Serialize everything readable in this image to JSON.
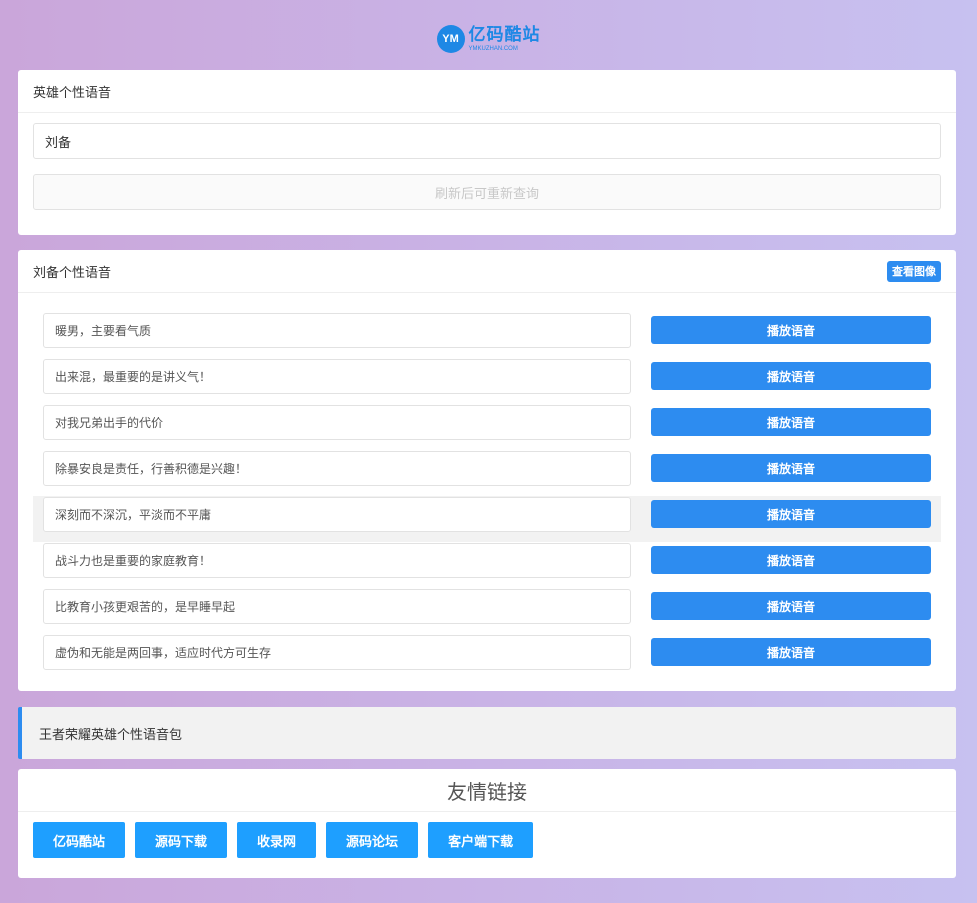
{
  "logo": {
    "mark": "YM",
    "title": "亿码酷站",
    "subtitle": "YMKUZHAN.COM"
  },
  "search_card": {
    "title": "英雄个性语音",
    "input_value": "刘备",
    "button_label": "刷新后可重新查询"
  },
  "result_card": {
    "title": "刘备个性语音",
    "view_image_label": "查看图像",
    "play_label": "播放语音",
    "quotes": [
      "暖男，主要看气质",
      "出来混，最重要的是讲义气！",
      "对我兄弟出手的代价",
      "除暴安良是责任，行善积德是兴趣！",
      "深刻而不深沉，平淡而不平庸",
      "战斗力也是重要的家庭教育！",
      "比教育小孩更艰苦的，是早睡早起",
      "虚伪和无能是两回事，适应时代方可生存"
    ]
  },
  "notice": {
    "text": "王者荣耀英雄个性语音包"
  },
  "links_card": {
    "title": "友情链接",
    "links": [
      "亿码酷站",
      "源码下载",
      "收录网",
      "源码论坛",
      "客户端下载"
    ]
  },
  "colors": {
    "accent": "#2d8cf0",
    "link": "#1e9fff"
  }
}
